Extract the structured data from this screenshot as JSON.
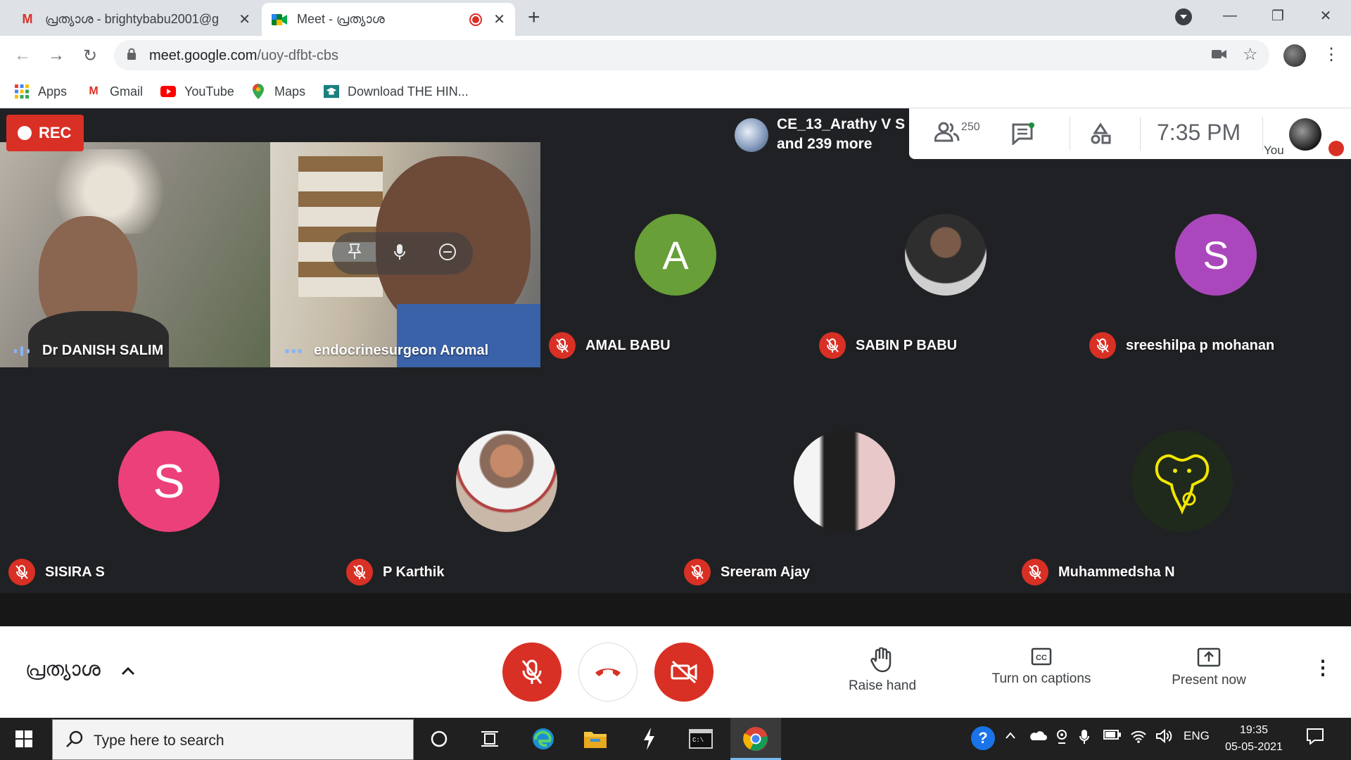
{
  "browser": {
    "tabs": [
      {
        "title": "പ്രത്യാശ - brightybabu2001@g",
        "icon": "gmail-icon"
      },
      {
        "title": "Meet - പ്രത്യാശ",
        "icon": "meet-icon",
        "recording": true
      }
    ],
    "url_host": "meet.google.com",
    "url_path": "/uoy-dfbt-cbs",
    "bookmarks": [
      {
        "label": "Apps",
        "icon": "apps-grid-icon"
      },
      {
        "label": "Gmail",
        "icon": "gmail-icon"
      },
      {
        "label": "YouTube",
        "icon": "youtube-icon"
      },
      {
        "label": "Maps",
        "icon": "maps-icon"
      },
      {
        "label": "Download THE HIN...",
        "icon": "graduation-cap-icon"
      }
    ]
  },
  "meet": {
    "rec_label": "REC",
    "presenter_name": "CE_13_Arathy V S",
    "presenter_more": "and 239 more",
    "participant_count": "250",
    "time": "7:35 PM",
    "self_label": "You",
    "participants_row1": [
      {
        "name": "Dr DANISH SALIM",
        "state": "speaking",
        "kind": "video"
      },
      {
        "name": "endocrinesurgeon Aromal",
        "state": "active",
        "kind": "video"
      },
      {
        "name": "AMAL BABU",
        "state": "muted",
        "kind": "letter",
        "letter": "A",
        "color": "#689f38"
      },
      {
        "name": "SABIN P BABU",
        "state": "muted",
        "kind": "photo"
      },
      {
        "name": "sreeshilpa p mohanan",
        "state": "muted",
        "kind": "letter",
        "letter": "S",
        "color": "#ab47bc"
      }
    ],
    "participants_row2": [
      {
        "name": "SISIRA S",
        "state": "muted",
        "kind": "letter",
        "letter": "S",
        "color": "#ec407a"
      },
      {
        "name": "P Karthik",
        "state": "muted",
        "kind": "photo"
      },
      {
        "name": "Sreeram Ajay",
        "state": "muted",
        "kind": "photo"
      },
      {
        "name": "Muhammedsha N",
        "state": "muted",
        "kind": "logo"
      }
    ],
    "meeting_name": "പ്രത്യാശ",
    "controls": {
      "raise_hand": "Raise hand",
      "captions": "Turn on captions",
      "present": "Present now"
    }
  },
  "taskbar": {
    "search_placeholder": "Type here to search",
    "language": "ENG",
    "clock_time": "19:35",
    "clock_date": "05-05-2021"
  },
  "colors": {
    "danger": "#d93025",
    "meet_bg": "#202124",
    "speaking": "#8ab4f8"
  }
}
